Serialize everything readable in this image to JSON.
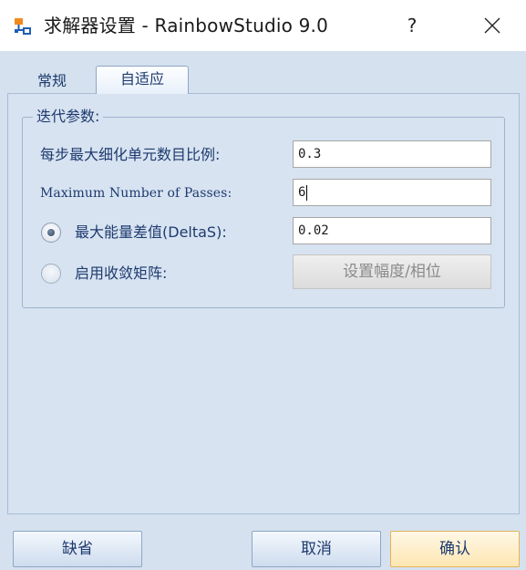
{
  "window": {
    "title": "求解器设置 - RainbowStudio 9.0",
    "help_glyph": "?",
    "app_icon": "network-icon"
  },
  "tabs": [
    {
      "label": "常规",
      "active": false
    },
    {
      "label": "自适应",
      "active": true
    }
  ],
  "group": {
    "title": "迭代参数:"
  },
  "fields": {
    "refine_ratio_label": "每步最大细化单元数目比例:",
    "refine_ratio_value": "0.3",
    "max_passes_label": "Maximum Number of Passes:",
    "max_passes_value": "6",
    "delta_energy_label": "最大能量差值(DeltaS):",
    "delta_energy_value": "0.02",
    "convergence_matrix_label": "启用收敛矩阵:",
    "set_magnitude_phase_label": "设置幅度/相位"
  },
  "radios": {
    "delta_energy_selected": true,
    "convergence_matrix_selected": false
  },
  "buttons": {
    "default_label": "缺省",
    "cancel_label": "取消",
    "ok_label": "确认"
  },
  "colors": {
    "client_bg": "#d5e1ef",
    "text_blue": "#1e3a6e",
    "ok_highlight": "#fde6b2"
  }
}
